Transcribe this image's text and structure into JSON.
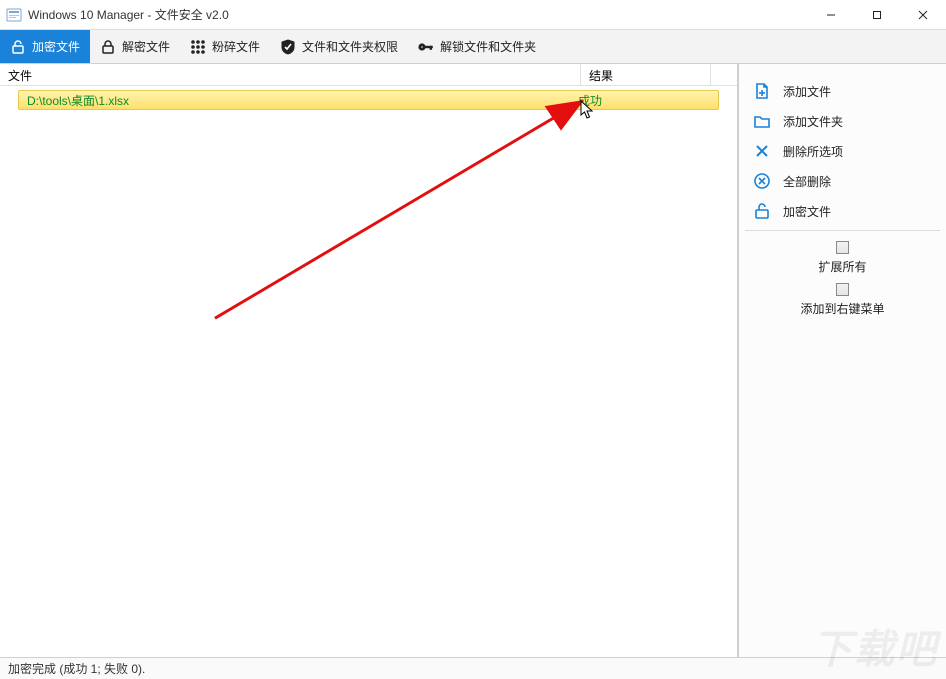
{
  "window": {
    "title": "Windows 10 Manager - 文件安全 v2.0"
  },
  "toolbar": {
    "items": [
      {
        "id": "encrypt",
        "label": "加密文件",
        "icon": "lock-open-icon",
        "active": true
      },
      {
        "id": "decrypt",
        "label": "解密文件",
        "icon": "lock-icon",
        "active": false
      },
      {
        "id": "shred",
        "label": "粉碎文件",
        "icon": "grid-icon",
        "active": false
      },
      {
        "id": "perm",
        "label": "文件和文件夹权限",
        "icon": "shield-check-icon",
        "active": false
      },
      {
        "id": "unlock",
        "label": "解锁文件和文件夹",
        "icon": "key-icon",
        "active": false
      }
    ]
  },
  "columns": {
    "file": "文件",
    "result": "结果"
  },
  "rows": [
    {
      "file": "D:\\tools\\桌面\\1.xlsx",
      "result": "成功"
    }
  ],
  "side": {
    "items": [
      {
        "id": "add-file",
        "label": "添加文件",
        "icon": "file-plus-icon"
      },
      {
        "id": "add-folder",
        "label": "添加文件夹",
        "icon": "folder-icon"
      },
      {
        "id": "remove-selected",
        "label": "删除所选项",
        "icon": "x-icon"
      },
      {
        "id": "remove-all",
        "label": "全部删除",
        "icon": "x-circle-icon"
      },
      {
        "id": "encrypt-files",
        "label": "加密文件",
        "icon": "lock-open-icon"
      }
    ],
    "checks": [
      {
        "id": "expand-all",
        "label": "扩展所有"
      },
      {
        "id": "add-context",
        "label": "添加到右键菜单"
      }
    ]
  },
  "status": {
    "text": "加密完成 (成功 1; 失败 0)."
  },
  "watermark": "下载吧"
}
